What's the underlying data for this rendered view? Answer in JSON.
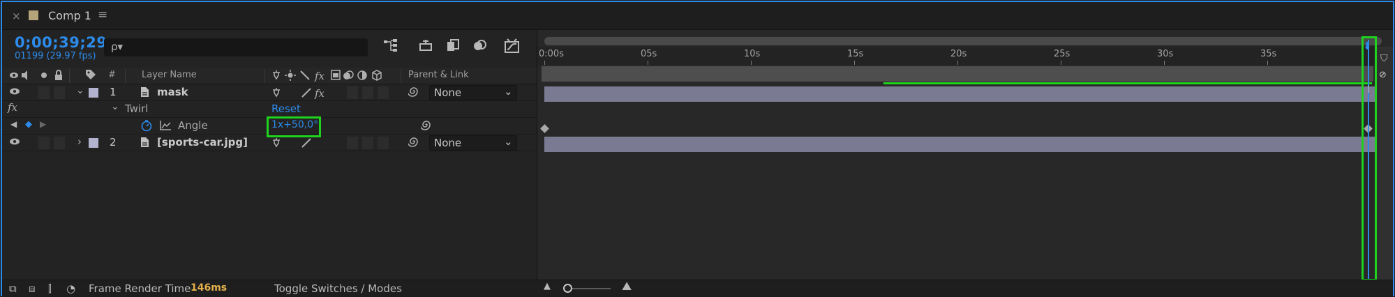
{
  "tab": {
    "close": "×",
    "title": "Comp 1",
    "menu": "≡"
  },
  "header": {
    "timecode": "0;00;39;29",
    "frames": "01199 (29.97 fps)",
    "search_icon": "ρ▾"
  },
  "columns": {
    "layer_name": "Layer Name",
    "num": "#",
    "parent_link": "Parent & Link"
  },
  "layers": [
    {
      "num": "1",
      "name": "mask",
      "parent": "None",
      "swatch": "#b3b3cf"
    },
    {
      "num": "2",
      "name": "[sports-car.jpg]",
      "parent": "None",
      "swatch": "#b3b3cf"
    }
  ],
  "effect": {
    "fx": "fx",
    "name": "Twirl",
    "reset": "Reset",
    "property": "Angle",
    "value": "1x+50,0°"
  },
  "timeline": {
    "labels": [
      "0:00s",
      "05s",
      "10s",
      "15s",
      "20s",
      "25s",
      "30s",
      "35s"
    ]
  },
  "footer": {
    "render_label": "Frame Render Time",
    "render_value": "146ms",
    "toggle": "Toggle Switches / Modes"
  },
  "colors": {
    "accent": "#2d8ceb",
    "highlight": "#1ed21e",
    "render_value": "#e3b04d"
  }
}
